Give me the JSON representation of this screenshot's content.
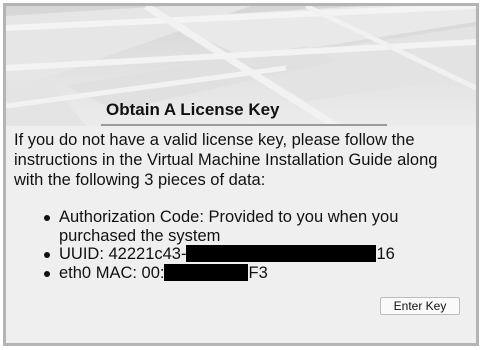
{
  "panel": {
    "title": "Obtain A License Key",
    "intro": "If you do not have a valid license key, please follow the instructions in the Virtual Machine Installation Guide along with the following 3 pieces of data:"
  },
  "items": [
    {
      "label": "Authorization Code: Provided to you when you purchased the system"
    },
    {
      "prefix": "UUID: 42221c43-",
      "suffix": "16"
    },
    {
      "prefix": "eth0 MAC: 00:",
      "suffix": "F3"
    }
  ],
  "button": {
    "label": "Enter Key"
  },
  "colors": {
    "frame_border": "#b4b4b4",
    "background": "#efefef",
    "redaction": "#000000"
  }
}
